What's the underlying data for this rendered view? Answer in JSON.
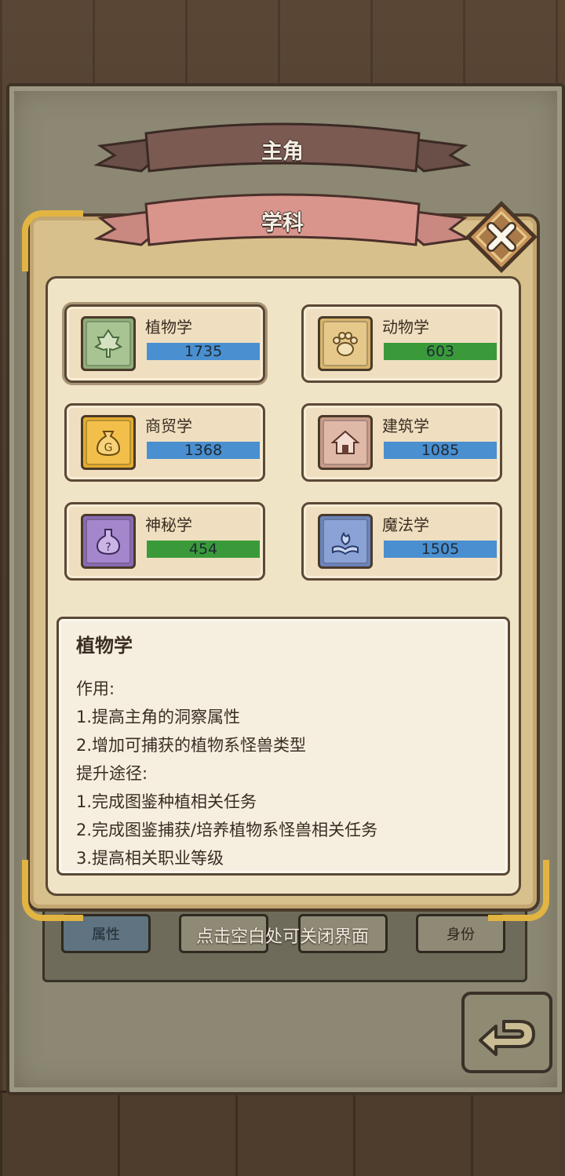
{
  "ribbons": {
    "top": "主角",
    "main": "学科"
  },
  "skills": [
    {
      "name": "植物学",
      "value": "1735",
      "bar_color": "#4a8fd0",
      "icon": "leaf-icon",
      "icon_bg": "#8fae78"
    },
    {
      "name": "动物学",
      "value": "603",
      "bar_color": "#3a9a3a",
      "icon": "paw-icon",
      "icon_bg": "#d8b46a"
    },
    {
      "name": "商贸学",
      "value": "1368",
      "bar_color": "#4a8fd0",
      "icon": "money-bag-icon",
      "icon_bg": "#e6ac2c"
    },
    {
      "name": "建筑学",
      "value": "1085",
      "bar_color": "#4a8fd0",
      "icon": "house-icon",
      "icon_bg": "#c99a88"
    },
    {
      "name": "神秘学",
      "value": "454",
      "bar_color": "#3a9a3a",
      "icon": "potion-icon",
      "icon_bg": "#8a6ab8"
    },
    {
      "name": "魔法学",
      "value": "1505",
      "bar_color": "#4a8fd0",
      "icon": "magic-book-icon",
      "icon_bg": "#6a84c0"
    }
  ],
  "description": {
    "title": "植物学",
    "lines": [
      "作用:",
      "1.提高主角的洞察属性",
      "2.增加可捕获的植物系怪兽类型",
      "提升途径:",
      "1.完成图鉴种植相关任务",
      "2.完成图鉴捕获/培养植物系怪兽相关任务",
      "3.提高相关职业等级"
    ]
  },
  "bottom_tabs": [
    "属性",
    "",
    "",
    "身份"
  ],
  "hint": "点击空白处可关闭界面"
}
